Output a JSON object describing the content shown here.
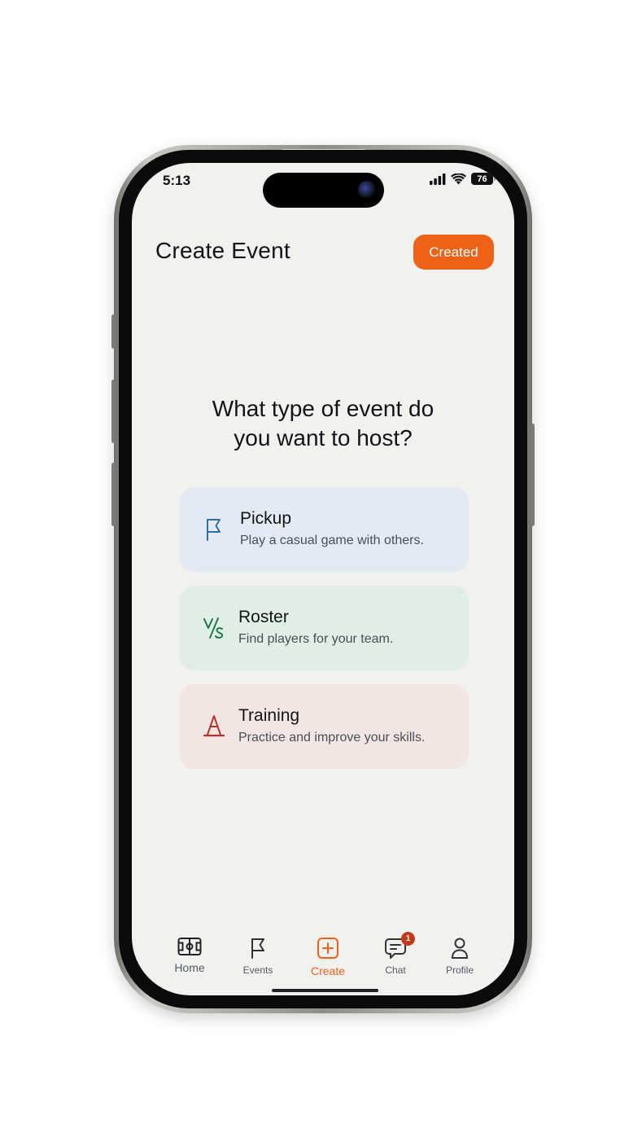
{
  "status_bar": {
    "time": "5:13",
    "battery": "76"
  },
  "header": {
    "title": "Create Event",
    "created_label": "Created"
  },
  "prompt": {
    "line1": "What type of event do",
    "line2": "you want to host?"
  },
  "options": [
    {
      "title": "Pickup",
      "description": "Play a casual game with others.",
      "icon": "flag-icon",
      "color": "#2f6fa3"
    },
    {
      "title": "Roster",
      "description": "Find players for your team.",
      "icon": "versus-icon",
      "color": "#1f7a4a"
    },
    {
      "title": "Training",
      "description": "Practice and improve your skills.",
      "icon": "cone-icon",
      "color": "#b5322a"
    }
  ],
  "tabs": [
    {
      "label": "Home",
      "icon": "field-icon"
    },
    {
      "label": "Events",
      "icon": "flag-icon"
    },
    {
      "label": "Create",
      "icon": "plus-square-icon",
      "active": true
    },
    {
      "label": "Chat",
      "icon": "chat-icon",
      "badge": "1"
    },
    {
      "label": "Profile",
      "icon": "person-icon"
    }
  ],
  "colors": {
    "accent": "#ee6217",
    "badge": "#c23a19",
    "background": "#f1f1f0"
  }
}
